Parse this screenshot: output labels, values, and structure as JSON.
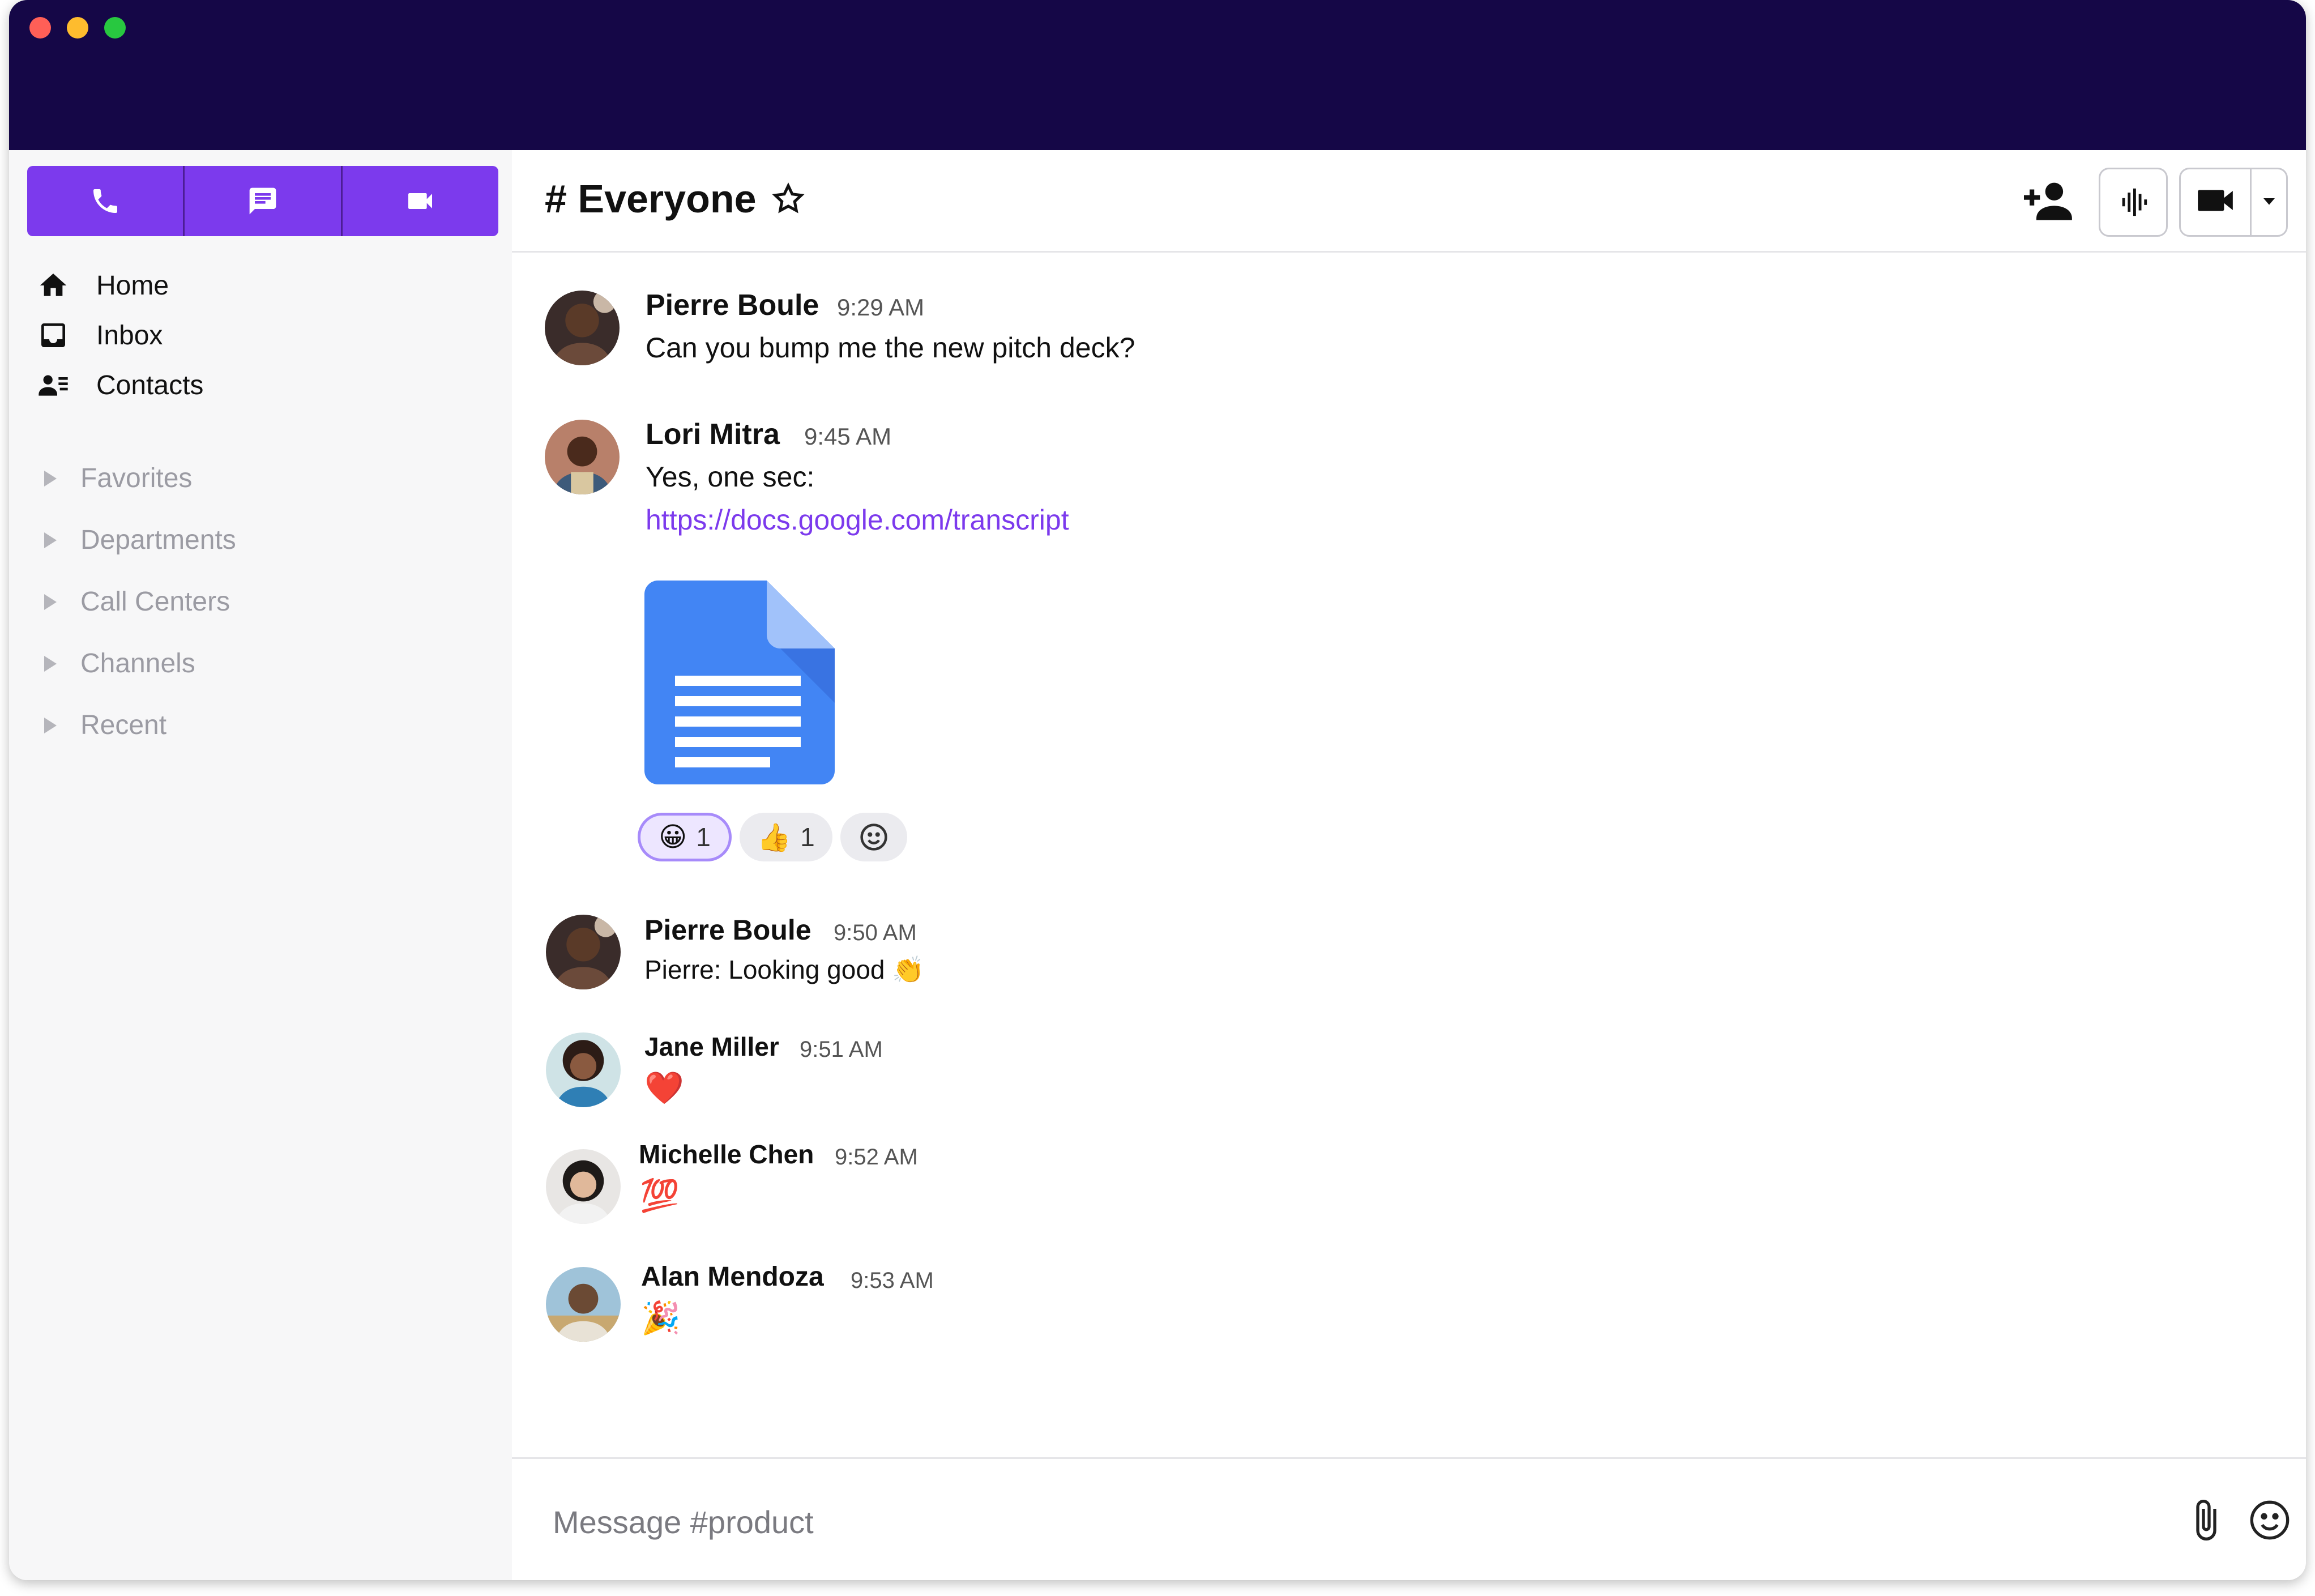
{
  "sidebar": {
    "mode_buttons": [
      {
        "icon": "phone-icon"
      },
      {
        "icon": "chat-icon"
      },
      {
        "icon": "video-icon"
      }
    ],
    "accent_color": "#7c3aed",
    "nav": [
      {
        "label": "Home",
        "icon": "home-icon"
      },
      {
        "label": "Inbox",
        "icon": "inbox-icon"
      },
      {
        "label": "Contacts",
        "icon": "contacts-icon"
      }
    ],
    "groups": [
      {
        "label": "Favorites"
      },
      {
        "label": "Departments"
      },
      {
        "label": "Call Centers"
      },
      {
        "label": "Channels"
      },
      {
        "label": "Recent"
      }
    ]
  },
  "header": {
    "channel_title": "# Everyone",
    "icons": [
      "star-icon",
      "add-user-icon",
      "audio-wave-icon",
      "video-camera-icon",
      "caret-down-icon"
    ]
  },
  "messages": [
    {
      "author": "Pierre Boule",
      "time": "9:29 AM",
      "text": "Can you bump me the new pitch deck?"
    },
    {
      "author": "Lori Mitra",
      "time": "9:45 AM",
      "text": "Yes, one sec:",
      "link": "https://docs.google.com/transcript",
      "attachment": "google-doc-icon",
      "reactions": [
        {
          "emoji": "😀",
          "count": "1",
          "active": true
        },
        {
          "emoji": "👍",
          "count": "1",
          "active": false
        }
      ]
    },
    {
      "author": "Pierre Boule",
      "time": "9:50 AM",
      "text": "Pierre: Looking good 👏"
    },
    {
      "author": "Jane Miller",
      "time": "9:51 AM",
      "text": "❤️"
    },
    {
      "author": "Michelle Chen",
      "time": "9:52 AM",
      "text": "💯"
    },
    {
      "author": "Alan Mendoza",
      "time": "9:53 AM",
      "text": "🎉"
    }
  ],
  "composer": {
    "placeholder": "Message #product"
  },
  "colors": {
    "titlebar": "#150747",
    "link": "#7c3aed",
    "doc_blue": "#4285f4"
  }
}
